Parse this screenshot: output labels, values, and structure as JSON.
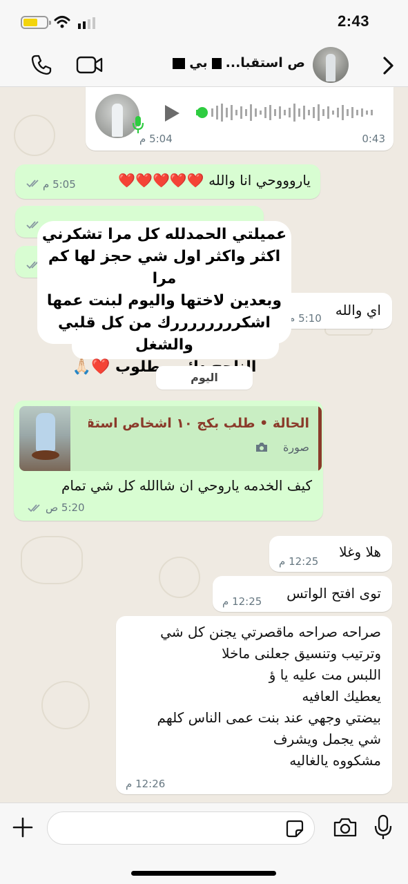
{
  "status_bar": {
    "time": "2:43"
  },
  "header": {
    "contact_name_part1": "ص استقبا...",
    "contact_name_part2": "بي"
  },
  "voice_message": {
    "duration": "0:43",
    "time": "5:04 م"
  },
  "messages": [
    {
      "id": "m1",
      "text": "ياروووحي انا والله ❤️❤️❤️❤️❤️",
      "time": "5:05 م",
      "direction": "out",
      "read": true
    },
    {
      "id": "m2",
      "text": "اي والله",
      "time": "5:10 م",
      "direction": "in"
    },
    {
      "id": "m3",
      "text": "كيف الخدمه ياروحي ان شاالله كل شي تمام",
      "time": "5:20 ص",
      "direction": "out",
      "read": true
    },
    {
      "id": "m4",
      "text": "هلا وغلا",
      "time": "12:25 م",
      "direction": "in"
    },
    {
      "id": "m5",
      "text": "توى افتح الواتس",
      "time": "12:25 م",
      "direction": "in"
    },
    {
      "id": "m6",
      "lines": [
        "صراحه صراحه ماقصرتي يجنن كل شي",
        "وترتيب وتنسيق جعلنى ماخلا",
        "اللبس مت عليه يا ؤ",
        "يعطيك العافيه",
        "بيضتي وجهي عند بنت عمى الناس كلهم",
        "شي يجمل ويشرف",
        "مشكووه يالغاليه"
      ],
      "time": "12:26 م",
      "direction": "in"
    }
  ],
  "sticker": {
    "lines": [
      "عميلتي الحمدلله كل مرا تشكرني",
      "اكثر واكثر اول شي حجز لها كم مرا",
      "وبعدين لاختها واليوم لبنت عمها",
      "اشكررررررررك من كل قلبي والشغل",
      "الناجح دائم مطلوب ❤️🙏🏻"
    ]
  },
  "date_divider": "اليوم",
  "reply_quote": {
    "title": "الحالة • طلب بكج ١٠ اشخاص استقبا...",
    "subtitle": "صورة"
  },
  "input": {
    "value": ""
  },
  "colors": {
    "outgoing_bubble": "#d8fdd2",
    "incoming_bubble": "#ffffff",
    "wallpaper": "#efeae2",
    "voice_accent": "#2ecc40",
    "quote_accent": "#8a3a2a"
  }
}
